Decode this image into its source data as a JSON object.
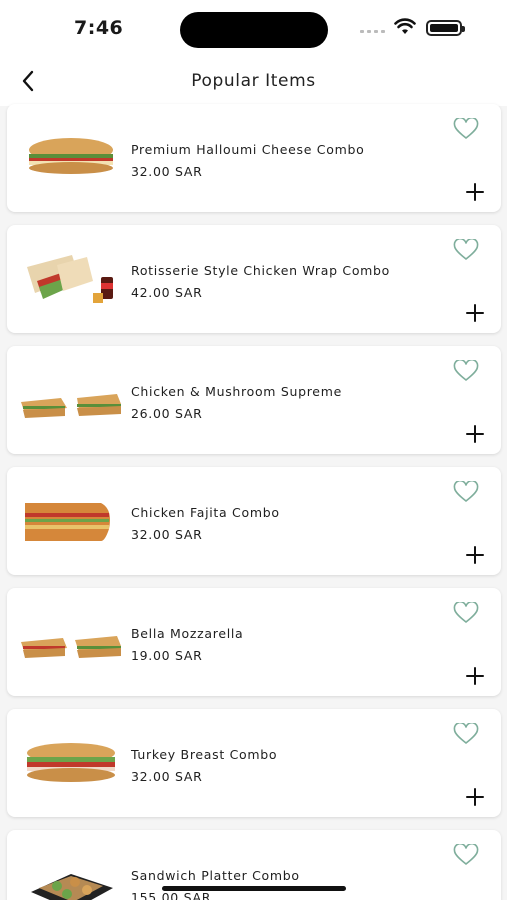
{
  "status_bar": {
    "time": "7:46"
  },
  "header": {
    "title": "Popular Items",
    "back_icon": "chevron-left-icon"
  },
  "colors": {
    "accent": "#7fae9c",
    "text": "#1f1f1f",
    "background": "#f5f5f5"
  },
  "items": [
    {
      "name": "Premium Halloumi Cheese Combo",
      "price": "32.00 SAR",
      "image": "sub-sandwich-image"
    },
    {
      "name": "Rotisserie Style Chicken Wrap Combo",
      "price": "42.00 SAR",
      "image": "wrap-combo-image"
    },
    {
      "name": "Chicken & Mushroom Supreme",
      "price": "26.00 SAR",
      "image": "sandwich-halves-image"
    },
    {
      "name": "Chicken Fajita Combo",
      "price": "32.00 SAR",
      "image": "sub-sandwich-image"
    },
    {
      "name": "Bella Mozzarella",
      "price": "19.00 SAR",
      "image": "sandwich-halves-image"
    },
    {
      "name": "Turkey Breast Combo",
      "price": "32.00 SAR",
      "image": "sub-sandwich-image"
    },
    {
      "name": "Sandwich Platter Combo",
      "price": "155.00 SAR",
      "image": "platter-image"
    }
  ]
}
